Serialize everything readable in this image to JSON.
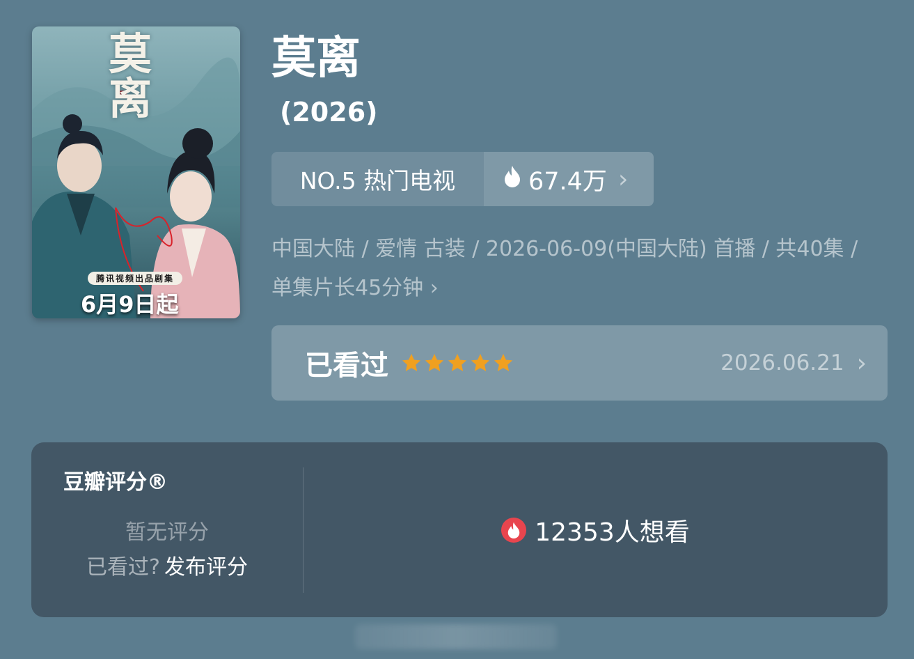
{
  "poster": {
    "title": "莫离",
    "tag": "腾讯视频出品剧集",
    "date": "6月9日起"
  },
  "header": {
    "title": "莫离",
    "year": "(2026)"
  },
  "rank": {
    "label": "NO.5 热门电视",
    "heat": "67.4万"
  },
  "meta": {
    "text": "中国大陆 / 爱情 古装 / 2026-06-09(中国大陆) 首播 / 共40集 / 单集片长45分钟"
  },
  "watched": {
    "label": "已看过",
    "stars": 5,
    "date": "2026.06.21"
  },
  "rating": {
    "title": "豆瓣评分®",
    "none": "暂无评分",
    "question": "已看过?",
    "publish": "发布评分",
    "want": "12353人想看"
  },
  "colors": {
    "background": "#5c7d8f",
    "card": "#435766",
    "star": "#f0a020",
    "hot": "#e8454e"
  }
}
